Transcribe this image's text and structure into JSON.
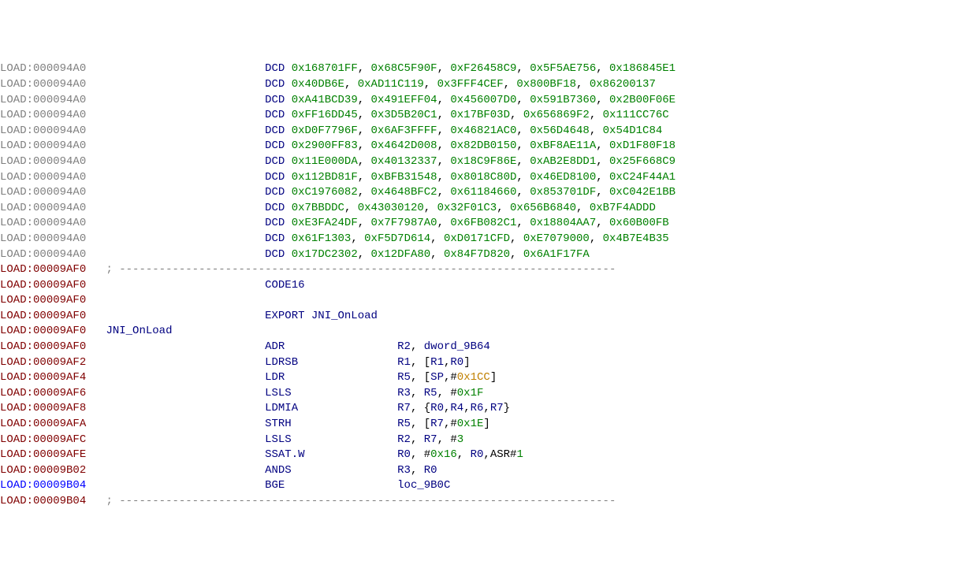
{
  "lines": [
    {
      "seg": "LOAD:",
      "segc": "seg",
      "addr": "000094A0",
      "col1": "",
      "col2": "DCD",
      "col2c": "mnem",
      "rest": [
        {
          "t": "0x168701FF",
          "c": "hex"
        },
        {
          "t": ", ",
          "c": "punct"
        },
        {
          "t": "0x68C5F90F",
          "c": "hex"
        },
        {
          "t": ", ",
          "c": "punct"
        },
        {
          "t": "0xF26458C9",
          "c": "hex"
        },
        {
          "t": ", ",
          "c": "punct"
        },
        {
          "t": "0x5F5AE756",
          "c": "hex"
        },
        {
          "t": ", ",
          "c": "punct"
        },
        {
          "t": "0x186845E1",
          "c": "hex"
        }
      ]
    },
    {
      "seg": "LOAD:",
      "segc": "seg",
      "addr": "000094A0",
      "col1": "",
      "col2": "DCD",
      "col2c": "mnem",
      "rest": [
        {
          "t": "0x40DB6E",
          "c": "hex"
        },
        {
          "t": ", ",
          "c": "punct"
        },
        {
          "t": "0xAD11C119",
          "c": "hex"
        },
        {
          "t": ", ",
          "c": "punct"
        },
        {
          "t": "0x3FFF4CEF",
          "c": "hex"
        },
        {
          "t": ", ",
          "c": "punct"
        },
        {
          "t": "0x800BF18",
          "c": "hex"
        },
        {
          "t": ", ",
          "c": "punct"
        },
        {
          "t": "0x86200137",
          "c": "hex"
        }
      ]
    },
    {
      "seg": "LOAD:",
      "segc": "seg",
      "addr": "000094A0",
      "col1": "",
      "col2": "DCD",
      "col2c": "mnem",
      "rest": [
        {
          "t": "0xA41BCD39",
          "c": "hex"
        },
        {
          "t": ", ",
          "c": "punct"
        },
        {
          "t": "0x491EFF04",
          "c": "hex"
        },
        {
          "t": ", ",
          "c": "punct"
        },
        {
          "t": "0x456007D0",
          "c": "hex"
        },
        {
          "t": ", ",
          "c": "punct"
        },
        {
          "t": "0x591B7360",
          "c": "hex"
        },
        {
          "t": ", ",
          "c": "punct"
        },
        {
          "t": "0x2B00F06E",
          "c": "hex"
        }
      ]
    },
    {
      "seg": "LOAD:",
      "segc": "seg",
      "addr": "000094A0",
      "col1": "",
      "col2": "DCD",
      "col2c": "mnem",
      "rest": [
        {
          "t": "0xFF16DD45",
          "c": "hex"
        },
        {
          "t": ", ",
          "c": "punct"
        },
        {
          "t": "0x3D5B20C1",
          "c": "hex"
        },
        {
          "t": ", ",
          "c": "punct"
        },
        {
          "t": "0x17BF03D",
          "c": "hex"
        },
        {
          "t": ", ",
          "c": "punct"
        },
        {
          "t": "0x656869F2",
          "c": "hex"
        },
        {
          "t": ", ",
          "c": "punct"
        },
        {
          "t": "0x111CC76C",
          "c": "hex"
        }
      ]
    },
    {
      "seg": "LOAD:",
      "segc": "seg",
      "addr": "000094A0",
      "col1": "",
      "col2": "DCD",
      "col2c": "mnem",
      "rest": [
        {
          "t": "0xD0F7796F",
          "c": "hex"
        },
        {
          "t": ", ",
          "c": "punct"
        },
        {
          "t": "0x6AF3FFFF",
          "c": "hex"
        },
        {
          "t": ", ",
          "c": "punct"
        },
        {
          "t": "0x46821AC0",
          "c": "hex"
        },
        {
          "t": ", ",
          "c": "punct"
        },
        {
          "t": "0x56D4648",
          "c": "hex"
        },
        {
          "t": ", ",
          "c": "punct"
        },
        {
          "t": "0x54D1C84",
          "c": "hex"
        }
      ]
    },
    {
      "seg": "LOAD:",
      "segc": "seg",
      "addr": "000094A0",
      "col1": "",
      "col2": "DCD",
      "col2c": "mnem",
      "rest": [
        {
          "t": "0x2900FF83",
          "c": "hex"
        },
        {
          "t": ", ",
          "c": "punct"
        },
        {
          "t": "0x4642D008",
          "c": "hex"
        },
        {
          "t": ", ",
          "c": "punct"
        },
        {
          "t": "0x82DB0150",
          "c": "hex"
        },
        {
          "t": ", ",
          "c": "punct"
        },
        {
          "t": "0xBF8AE11A",
          "c": "hex"
        },
        {
          "t": ", ",
          "c": "punct"
        },
        {
          "t": "0xD1F80F18",
          "c": "hex"
        }
      ]
    },
    {
      "seg": "LOAD:",
      "segc": "seg",
      "addr": "000094A0",
      "col1": "",
      "col2": "DCD",
      "col2c": "mnem",
      "rest": [
        {
          "t": "0x11E000DA",
          "c": "hex"
        },
        {
          "t": ", ",
          "c": "punct"
        },
        {
          "t": "0x40132337",
          "c": "hex"
        },
        {
          "t": ", ",
          "c": "punct"
        },
        {
          "t": "0x18C9F86E",
          "c": "hex"
        },
        {
          "t": ", ",
          "c": "punct"
        },
        {
          "t": "0xAB2E8DD1",
          "c": "hex"
        },
        {
          "t": ", ",
          "c": "punct"
        },
        {
          "t": "0x25F668C9",
          "c": "hex"
        }
      ]
    },
    {
      "seg": "LOAD:",
      "segc": "seg",
      "addr": "000094A0",
      "col1": "",
      "col2": "DCD",
      "col2c": "mnem",
      "rest": [
        {
          "t": "0x112BD81F",
          "c": "hex"
        },
        {
          "t": ", ",
          "c": "punct"
        },
        {
          "t": "0xBFB31548",
          "c": "hex"
        },
        {
          "t": ", ",
          "c": "punct"
        },
        {
          "t": "0x8018C80D",
          "c": "hex"
        },
        {
          "t": ", ",
          "c": "punct"
        },
        {
          "t": "0x46ED8100",
          "c": "hex"
        },
        {
          "t": ", ",
          "c": "punct"
        },
        {
          "t": "0xC24F44A1",
          "c": "hex"
        }
      ]
    },
    {
      "seg": "LOAD:",
      "segc": "seg",
      "addr": "000094A0",
      "col1": "",
      "col2": "DCD",
      "col2c": "mnem",
      "rest": [
        {
          "t": "0xC1976082",
          "c": "hex"
        },
        {
          "t": ", ",
          "c": "punct"
        },
        {
          "t": "0x4648BFC2",
          "c": "hex"
        },
        {
          "t": ", ",
          "c": "punct"
        },
        {
          "t": "0x61184660",
          "c": "hex"
        },
        {
          "t": ", ",
          "c": "punct"
        },
        {
          "t": "0x853701DF",
          "c": "hex"
        },
        {
          "t": ", ",
          "c": "punct"
        },
        {
          "t": "0xC042E1BB",
          "c": "hex"
        }
      ]
    },
    {
      "seg": "LOAD:",
      "segc": "seg",
      "addr": "000094A0",
      "col1": "",
      "col2": "DCD",
      "col2c": "mnem",
      "rest": [
        {
          "t": "0x7BBDDC",
          "c": "hex"
        },
        {
          "t": ", ",
          "c": "punct"
        },
        {
          "t": "0x43030120",
          "c": "hex"
        },
        {
          "t": ", ",
          "c": "punct"
        },
        {
          "t": "0x32F01C3",
          "c": "hex"
        },
        {
          "t": ", ",
          "c": "punct"
        },
        {
          "t": "0x656B6840",
          "c": "hex"
        },
        {
          "t": ", ",
          "c": "punct"
        },
        {
          "t": "0xB7F4ADDD",
          "c": "hex"
        }
      ]
    },
    {
      "seg": "LOAD:",
      "segc": "seg",
      "addr": "000094A0",
      "col1": "",
      "col2": "DCD",
      "col2c": "mnem",
      "rest": [
        {
          "t": "0xE3FA24DF",
          "c": "hex"
        },
        {
          "t": ", ",
          "c": "punct"
        },
        {
          "t": "0x7F7987A0",
          "c": "hex"
        },
        {
          "t": ", ",
          "c": "punct"
        },
        {
          "t": "0x6FB082C1",
          "c": "hex"
        },
        {
          "t": ", ",
          "c": "punct"
        },
        {
          "t": "0x18804AA7",
          "c": "hex"
        },
        {
          "t": ", ",
          "c": "punct"
        },
        {
          "t": "0x60B00FB",
          "c": "hex"
        }
      ]
    },
    {
      "seg": "LOAD:",
      "segc": "seg",
      "addr": "000094A0",
      "col1": "",
      "col2": "DCD",
      "col2c": "mnem",
      "rest": [
        {
          "t": "0x61F1303",
          "c": "hex"
        },
        {
          "t": ", ",
          "c": "punct"
        },
        {
          "t": "0xF5D7D614",
          "c": "hex"
        },
        {
          "t": ", ",
          "c": "punct"
        },
        {
          "t": "0xD0171CFD",
          "c": "hex"
        },
        {
          "t": ", ",
          "c": "punct"
        },
        {
          "t": "0xE7079000",
          "c": "hex"
        },
        {
          "t": ", ",
          "c": "punct"
        },
        {
          "t": "0x4B7E4B35",
          "c": "hex"
        }
      ]
    },
    {
      "seg": "LOAD:",
      "segc": "seg",
      "addr": "000094A0",
      "col1": "",
      "col2": "DCD",
      "col2c": "mnem",
      "rest": [
        {
          "t": "0x17DC2302",
          "c": "hex"
        },
        {
          "t": ", ",
          "c": "punct"
        },
        {
          "t": "0x12DFA80",
          "c": "hex"
        },
        {
          "t": ", ",
          "c": "punct"
        },
        {
          "t": "0x84F7D820",
          "c": "hex"
        },
        {
          "t": ", ",
          "c": "punct"
        },
        {
          "t": "0x6A1F17FA",
          "c": "hex"
        }
      ]
    },
    {
      "seg": "LOAD:",
      "segc": "segr",
      "addr": "00009AF0",
      "col1": "",
      "col2": "; ---------------------------------------------------------------------------",
      "col2c": "cmt",
      "rest": [],
      "col2at": 1
    },
    {
      "seg": "LOAD:",
      "segc": "segr",
      "addr": "00009AF0",
      "col1": "",
      "col2": "CODE16",
      "col2c": "mnem",
      "rest": []
    },
    {
      "seg": "LOAD:",
      "segc": "segr",
      "addr": "00009AF0",
      "col1": "",
      "col2": "",
      "col2c": "",
      "rest": []
    },
    {
      "seg": "LOAD:",
      "segc": "segr",
      "addr": "00009AF0",
      "col1": "",
      "col2": "EXPORT JNI_OnLoad",
      "col2c": "mnem",
      "rest": []
    },
    {
      "seg": "LOAD:",
      "segc": "segr",
      "addr": "00009AF0",
      "col1": "JNI_OnLoad",
      "col1c": "sym",
      "col2": "",
      "col2c": "",
      "rest": []
    },
    {
      "seg": "LOAD:",
      "segc": "segr",
      "addr": "00009AF0",
      "col1": "",
      "col2": "ADR",
      "col2c": "mnem",
      "restcol": 3,
      "rest": [
        {
          "t": "R2",
          "c": "reg"
        },
        {
          "t": ", ",
          "c": "punct"
        },
        {
          "t": "dword_9B64",
          "c": "sym"
        }
      ]
    },
    {
      "seg": "LOAD:",
      "segc": "segr",
      "addr": "00009AF2",
      "col1": "",
      "col2": "LDRSB",
      "col2c": "mnem",
      "restcol": 3,
      "rest": [
        {
          "t": "R1",
          "c": "reg"
        },
        {
          "t": ", ",
          "c": "punct"
        },
        {
          "t": "[",
          "c": "punct"
        },
        {
          "t": "R1",
          "c": "reg"
        },
        {
          "t": ",",
          "c": "punct"
        },
        {
          "t": "R0",
          "c": "reg"
        },
        {
          "t": "]",
          "c": "punct"
        }
      ]
    },
    {
      "seg": "LOAD:",
      "segc": "segr",
      "addr": "00009AF4",
      "col1": "",
      "col2": "LDR",
      "col2c": "mnem",
      "restcol": 3,
      "rest": [
        {
          "t": "R5",
          "c": "reg"
        },
        {
          "t": ", ",
          "c": "punct"
        },
        {
          "t": "[",
          "c": "punct"
        },
        {
          "t": "SP",
          "c": "reg"
        },
        {
          "t": ",",
          "c": "punct"
        },
        {
          "t": "#",
          "c": "punct"
        },
        {
          "t": "0x1CC",
          "c": "immx"
        },
        {
          "t": "]",
          "c": "punct"
        }
      ]
    },
    {
      "seg": "LOAD:",
      "segc": "segr",
      "addr": "00009AF6",
      "col1": "",
      "col2": "LSLS",
      "col2c": "mnem",
      "restcol": 3,
      "rest": [
        {
          "t": "R3",
          "c": "reg"
        },
        {
          "t": ", ",
          "c": "punct"
        },
        {
          "t": "R5",
          "c": "reg"
        },
        {
          "t": ", ",
          "c": "punct"
        },
        {
          "t": "#",
          "c": "punct"
        },
        {
          "t": "0x1F",
          "c": "imm"
        }
      ]
    },
    {
      "seg": "LOAD:",
      "segc": "segr",
      "addr": "00009AF8",
      "col1": "",
      "col2": "LDMIA",
      "col2c": "mnem",
      "restcol": 3,
      "rest": [
        {
          "t": "R7",
          "c": "reg"
        },
        {
          "t": ", ",
          "c": "punct"
        },
        {
          "t": "{",
          "c": "punct"
        },
        {
          "t": "R0",
          "c": "reg"
        },
        {
          "t": ",",
          "c": "punct"
        },
        {
          "t": "R4",
          "c": "reg"
        },
        {
          "t": ",",
          "c": "punct"
        },
        {
          "t": "R6",
          "c": "reg"
        },
        {
          "t": ",",
          "c": "punct"
        },
        {
          "t": "R7",
          "c": "reg"
        },
        {
          "t": "}",
          "c": "punct"
        }
      ]
    },
    {
      "seg": "LOAD:",
      "segc": "segr",
      "addr": "00009AFA",
      "col1": "",
      "col2": "STRH",
      "col2c": "mnem",
      "restcol": 3,
      "rest": [
        {
          "t": "R5",
          "c": "reg"
        },
        {
          "t": ", ",
          "c": "punct"
        },
        {
          "t": "[",
          "c": "punct"
        },
        {
          "t": "R7",
          "c": "reg"
        },
        {
          "t": ",",
          "c": "punct"
        },
        {
          "t": "#",
          "c": "punct"
        },
        {
          "t": "0x1E",
          "c": "imm"
        },
        {
          "t": "]",
          "c": "punct"
        }
      ]
    },
    {
      "seg": "LOAD:",
      "segc": "segr",
      "addr": "00009AFC",
      "col1": "",
      "col2": "LSLS",
      "col2c": "mnem",
      "restcol": 3,
      "rest": [
        {
          "t": "R2",
          "c": "reg"
        },
        {
          "t": ", ",
          "c": "punct"
        },
        {
          "t": "R7",
          "c": "reg"
        },
        {
          "t": ", ",
          "c": "punct"
        },
        {
          "t": "#",
          "c": "punct"
        },
        {
          "t": "3",
          "c": "imm"
        }
      ]
    },
    {
      "seg": "LOAD:",
      "segc": "segr",
      "addr": "00009AFE",
      "col1": "",
      "col2": "SSAT.W",
      "col2c": "mnem",
      "restcol": 3,
      "rest": [
        {
          "t": "R0",
          "c": "reg"
        },
        {
          "t": ", ",
          "c": "punct"
        },
        {
          "t": "#",
          "c": "punct"
        },
        {
          "t": "0x16",
          "c": "imm"
        },
        {
          "t": ", ",
          "c": "punct"
        },
        {
          "t": "R0",
          "c": "reg"
        },
        {
          "t": ",",
          "c": "punct"
        },
        {
          "t": "ASR",
          "c": "txt"
        },
        {
          "t": "#",
          "c": "punct"
        },
        {
          "t": "1",
          "c": "imm"
        }
      ]
    },
    {
      "seg": "LOAD:",
      "segc": "segr",
      "addr": "00009B02",
      "col1": "",
      "col2": "ANDS",
      "col2c": "mnem",
      "restcol": 3,
      "rest": [
        {
          "t": "R3",
          "c": "reg"
        },
        {
          "t": ", ",
          "c": "punct"
        },
        {
          "t": "R0",
          "c": "reg"
        }
      ]
    },
    {
      "seg": "LOAD:",
      "segc": "segb",
      "addr": "00009B04",
      "col1": "",
      "col2": "BGE",
      "col2c": "mnem",
      "restcol": 3,
      "rest": [
        {
          "t": "loc_9B0C",
          "c": "sym"
        }
      ]
    },
    {
      "seg": "LOAD:",
      "segc": "segr",
      "addr": "00009B04",
      "col1": "",
      "col2": "; ---------------------------------------------------------------------------",
      "col2c": "cmt",
      "rest": [],
      "col2at": 1
    }
  ],
  "cols": {
    "c1": 16,
    "c2": 40,
    "c3": 60
  }
}
